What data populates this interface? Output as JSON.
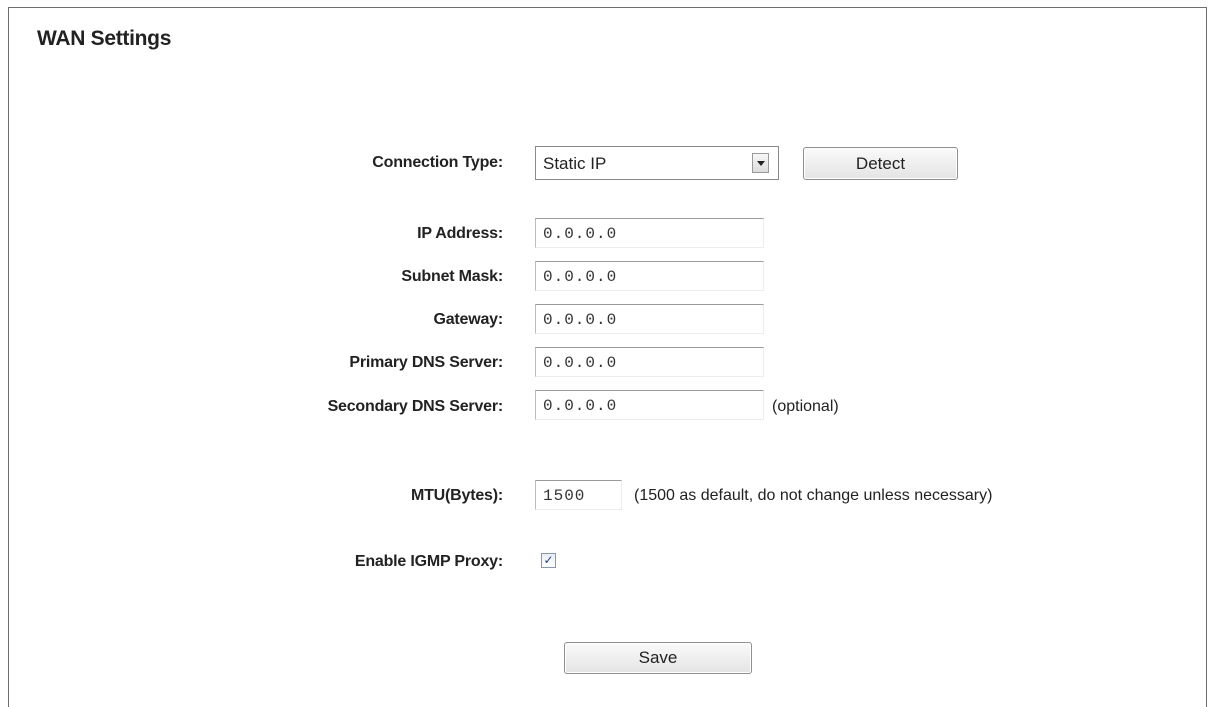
{
  "page": {
    "title": "WAN Settings"
  },
  "connection": {
    "label": "Connection Type:",
    "selected": "Static IP",
    "detect_label": "Detect"
  },
  "fields": {
    "ip_address": {
      "label": "IP Address:",
      "value": "0.0.0.0"
    },
    "subnet_mask": {
      "label": "Subnet Mask:",
      "value": "0.0.0.0"
    },
    "gateway": {
      "label": "Gateway:",
      "value": "0.0.0.0"
    },
    "primary_dns": {
      "label": "Primary DNS Server:",
      "value": "0.0.0.0"
    },
    "secondary_dns": {
      "label": "Secondary DNS Server:",
      "value": "0.0.0.0",
      "note": "(optional)"
    }
  },
  "mtu": {
    "label": "MTU(Bytes):",
    "value": "1500",
    "note": "(1500 as default, do not change unless necessary)"
  },
  "igmp": {
    "label": "Enable IGMP Proxy:",
    "checked": true,
    "check_glyph": "✓"
  },
  "save": {
    "label": "Save"
  },
  "colors": {
    "text": "#222222",
    "check": "#2a3d8f"
  }
}
